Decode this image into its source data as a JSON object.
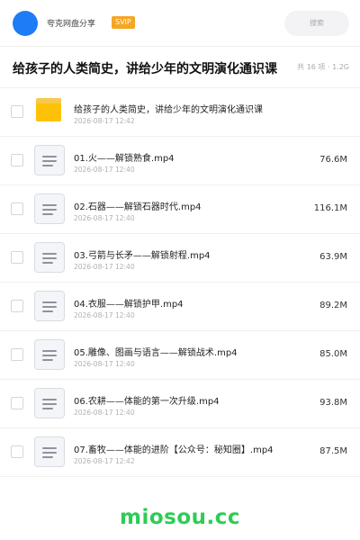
{
  "header": {
    "site_name": "夸克网盘分享",
    "badge": "SVIP",
    "search_label": "搜索"
  },
  "title_bar": {
    "title": "给孩子的人类简史，讲给少年的文明演化通识课",
    "meta": "共 16 项 · 1.2G"
  },
  "files": [
    {
      "type": "folder",
      "name": "给孩子的人类简史，讲给少年的文明演化通识课",
      "date": "2026-08-17 12:42",
      "size": ""
    },
    {
      "type": "file",
      "name": "01.火——解锁熟食.mp4",
      "date": "2026-08-17 12:40",
      "size": "76.6M"
    },
    {
      "type": "file",
      "name": "02.石器——解锁石器时代.mp4",
      "date": "2026-08-17 12:40",
      "size": "116.1M"
    },
    {
      "type": "file",
      "name": "03.弓箭与长矛——解锁射程.mp4",
      "date": "2026-08-17 12:40",
      "size": "63.9M"
    },
    {
      "type": "file",
      "name": "04.衣服——解锁护甲.mp4",
      "date": "2026-08-17 12:40",
      "size": "89.2M"
    },
    {
      "type": "file",
      "name": "05.雕像、图画与语言——解锁战术.mp4",
      "date": "2026-08-17 12:40",
      "size": "85.0M"
    },
    {
      "type": "file",
      "name": "06.农耕——体能的第一次升级.mp4",
      "date": "2026-08-17 12:40",
      "size": "93.8M"
    },
    {
      "type": "file",
      "name": "07.畜牧——体能的进阶【公众号：秘知圈】.mp4",
      "date": "2026-08-17 12:42",
      "size": "87.5M"
    }
  ],
  "watermark": "miosou.cc",
  "colors": {
    "avatar": "#1f7cf7",
    "badge": "#f5a623",
    "folder": "#ffc107",
    "watermark": "#2ecc55"
  }
}
